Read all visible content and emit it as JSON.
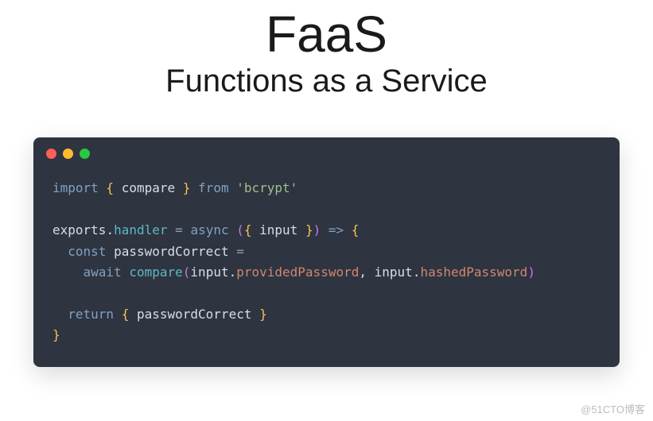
{
  "header": {
    "title": "FaaS",
    "subtitle": "Functions as a Service"
  },
  "code": {
    "line1": {
      "t1": "import",
      "t2": " { ",
      "t3": "compare",
      "t4": " } ",
      "t5": "from",
      "t6": " ",
      "t7": "'bcrypt'"
    },
    "line2": "",
    "line3": {
      "t1": "exports",
      "t2": ".",
      "t3": "handler",
      "t4": " ",
      "t5": "=",
      "t6": " ",
      "t7": "async",
      "t8": " (",
      "t9": "{ ",
      "t10": "input",
      "t11": " }",
      "t12": ")",
      "t13": " ",
      "t14": "=>",
      "t15": " ",
      "t16": "{"
    },
    "line4": {
      "t1": "  ",
      "t2": "const",
      "t3": " ",
      "t4": "passwordCorrect",
      "t5": " ",
      "t6": "="
    },
    "line5": {
      "t1": "    ",
      "t2": "await",
      "t3": " ",
      "t4": "compare",
      "t5": "(",
      "t6": "input",
      "t7": ".",
      "t8": "providedPassword",
      "t9": ",",
      "t10": " ",
      "t11": "input",
      "t12": ".",
      "t13": "hashedPassword",
      "t14": ")"
    },
    "line6": "",
    "line7": {
      "t1": "  ",
      "t2": "return",
      "t3": " ",
      "t4": "{ ",
      "t5": "passwordCorrect",
      "t6": " }"
    },
    "line8": {
      "t1": "}"
    }
  },
  "watermark": "@51CTO博客"
}
